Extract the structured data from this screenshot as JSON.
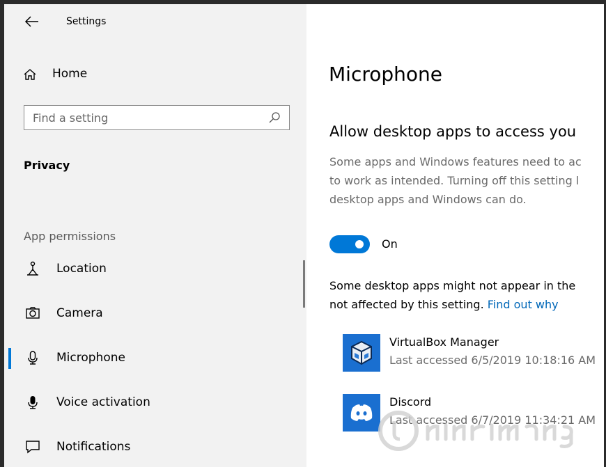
{
  "header": {
    "title": "Settings"
  },
  "sidebar": {
    "home_label": "Home",
    "search": {
      "placeholder": "Find a setting"
    },
    "section_title": "Privacy",
    "group_header": "App permissions",
    "items": [
      {
        "label": "Location",
        "icon": "location-icon",
        "selected": false
      },
      {
        "label": "Camera",
        "icon": "camera-icon",
        "selected": false
      },
      {
        "label": "Microphone",
        "icon": "microphone-icon",
        "selected": true
      },
      {
        "label": "Voice activation",
        "icon": "voice-activation-icon",
        "selected": false
      },
      {
        "label": "Notifications",
        "icon": "notifications-icon",
        "selected": false
      }
    ]
  },
  "main": {
    "page_title": "Microphone",
    "allow_heading": "Allow desktop apps to access you",
    "description": [
      "Some apps and Windows features need to ac",
      "to work as intended. Turning off this setting l",
      "desktop apps and Windows can do."
    ],
    "toggle": {
      "state": "On",
      "on": true
    },
    "note_line1": "Some desktop apps might not appear in the",
    "note_line2": "not affected by this setting.",
    "note_link": "Find out why",
    "apps": [
      {
        "name": "VirtualBox Manager",
        "last_accessed": "Last accessed 6/5/2019 10:18:16 AM",
        "icon": "virtualbox-icon"
      },
      {
        "name": "Discord",
        "last_accessed": "Last accessed 6/7/2019 11:34:21 AM",
        "icon": "discord-icon"
      }
    ]
  },
  "colors": {
    "accent": "#0078d7",
    "link": "#0067b8",
    "sidebar_bg": "#f2f2f2",
    "secondary_text": "#6b6b6b"
  }
}
